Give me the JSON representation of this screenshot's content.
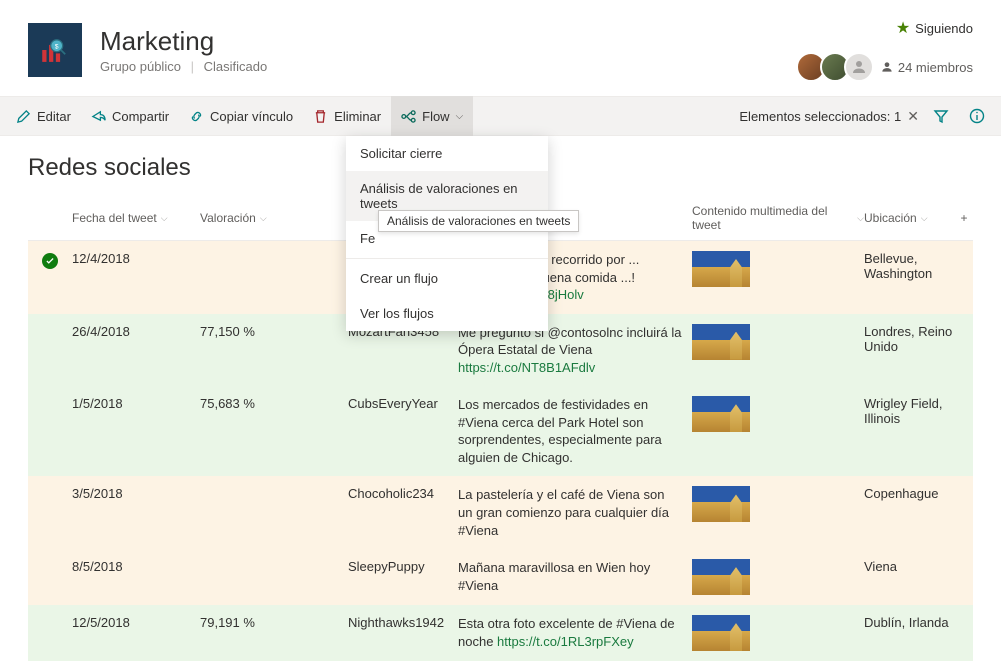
{
  "header": {
    "title": "Marketing",
    "group_type": "Grupo público",
    "classification": "Clasificado",
    "follow_label": "Siguiendo",
    "members_label": "24 miembros"
  },
  "cmdbar": {
    "edit": "Editar",
    "share": "Compartir",
    "copy_link": "Copiar vínculo",
    "delete": "Eliminar",
    "flow": "Flow",
    "selected": "Elementos seleccionados: 1"
  },
  "flow_menu": {
    "request_closure": "Solicitar cierre",
    "sentiment": "Análisis de valoraciones en tweets",
    "fe_truncated": "Fe",
    "create": "Crear un flujo",
    "view": "Ver los flujos",
    "tooltip": "Análisis de valoraciones en tweets"
  },
  "list": {
    "title": "Redes sociales",
    "cols": {
      "fecha": "Fecha del tweet",
      "valoracion": "Valoración",
      "usuario": "",
      "contenido": "",
      "media": "Contenido multimedia del tweet",
      "ubicacion": "Ubicación"
    }
  },
  "rows": [
    {
      "selected": true,
      "tone": "neu",
      "fecha": "12/4/2018",
      "val": "",
      "user": "",
      "cont_pre": "... publique otro recorrido por ... increíble con buena comida ...! ",
      "cont_link": "https://t.co/lEh28jHolv",
      "ubi": "Bellevue, Washington"
    },
    {
      "tone": "pos",
      "fecha": "26/4/2018",
      "val": "77,150 %",
      "user": "MozartFan3458",
      "cont_pre": "Me pregunto si @contosolnc incluirá la Ópera Estatal de Viena ",
      "cont_link": "https://t.co/NT8B1AFdlv",
      "ubi": "Londres, Reino Unido"
    },
    {
      "tone": "pos",
      "fecha": "1/5/2018",
      "val": "75,683 %",
      "user": "CubsEveryYear",
      "cont_pre": "Los mercados de festividades en #Viena cerca del Park Hotel son sorprendentes, especialmente para alguien de Chicago.",
      "cont_link": "",
      "ubi": "Wrigley Field, Illinois"
    },
    {
      "tone": "neu",
      "fecha": "3/5/2018",
      "val": "",
      "user": "Chocoholic234",
      "cont_pre": "La pastelería y el café de Viena son un gran comienzo para cualquier día #Viena",
      "cont_link": "",
      "ubi": "Copenhague"
    },
    {
      "tone": "neu",
      "fecha": "8/5/2018",
      "val": "",
      "user": "SleepyPuppy",
      "cont_pre": "Mañana maravillosa en Wien hoy #Viena",
      "cont_link": "",
      "ubi": "Viena"
    },
    {
      "tone": "pos",
      "fecha": "12/5/2018",
      "val": "79,191 %",
      "user": "Nighthawks1942",
      "cont_pre": "Esta otra foto excelente de #Viena de noche ",
      "cont_link": "https://t.co/1RL3rpFXey",
      "ubi": "Dublín, Irlanda"
    }
  ]
}
